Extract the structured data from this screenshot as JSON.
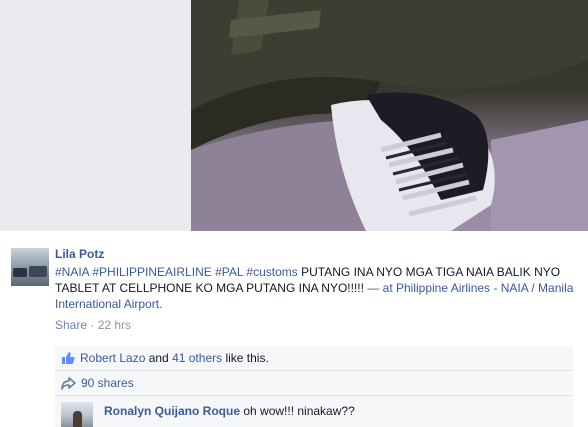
{
  "post": {
    "author": "Lila Potz",
    "hashtags": "#NAIA #PHILIPPINEAIRLINE #PAL #customs",
    "message": " PUTANG INA NYO MGA TIGA NAIA BALIK NYO TABLET AT CELLPHONE KO MGA PUTANG INA NYO!!!!! ",
    "location": "— at Philippine Airlines - NAIA / Manila International Airport.",
    "share_label": "Share",
    "separator": " · ",
    "time": "22 hrs"
  },
  "likes": {
    "liker": "Robert Lazo",
    "and": " and ",
    "others": "41 others",
    "suffix": " like this."
  },
  "shares": {
    "label": "90 shares"
  },
  "comment": {
    "author": "Ronalyn Quijano Roque",
    "text": " oh wow!!! ninakaw??"
  },
  "colors": {
    "link": "#3b5998",
    "meta": "#90949c",
    "ufi_bg": "#f6f7f9"
  },
  "icons": [
    "thumbs-up-icon",
    "share-arrow-icon"
  ]
}
